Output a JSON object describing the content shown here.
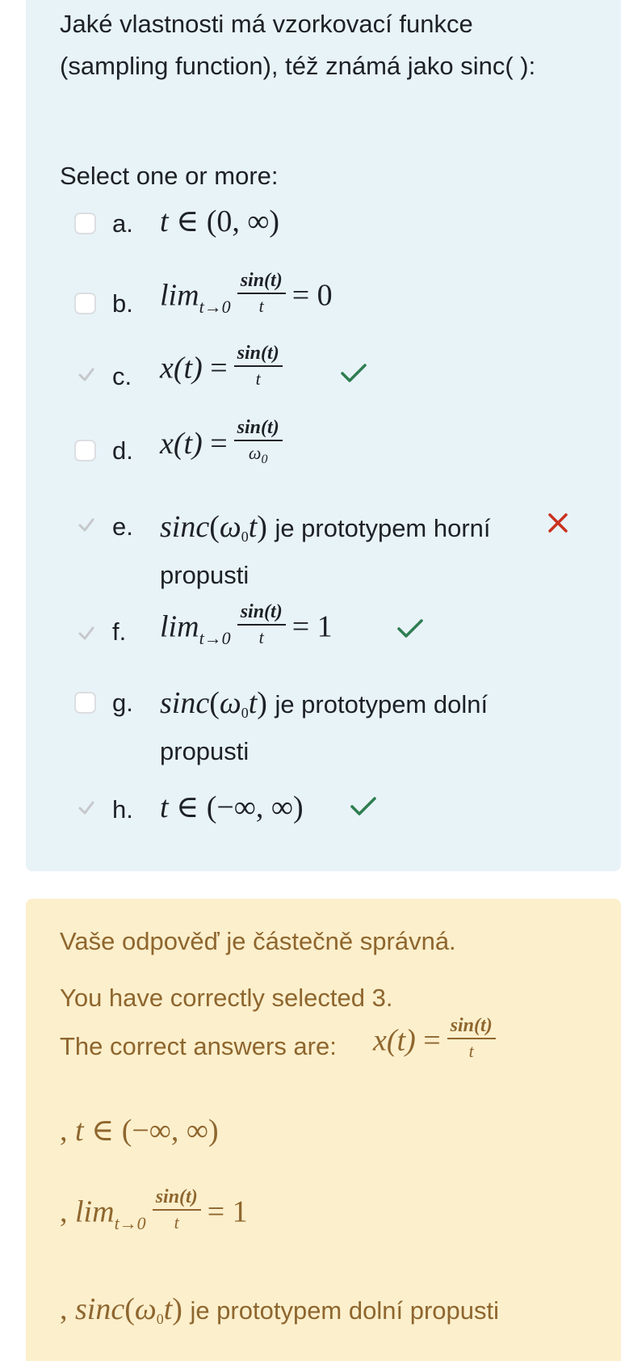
{
  "question": {
    "text": "Jaké vlastnosti má vzorkovací funkce (sampling function), též známá jako sinc( ):",
    "prompt": "Select one or more:"
  },
  "options": [
    {
      "letter": "a.",
      "checked": false,
      "result": null
    },
    {
      "letter": "b.",
      "checked": false,
      "result": null
    },
    {
      "letter": "c.",
      "checked": true,
      "result": "correct"
    },
    {
      "letter": "d.",
      "checked": false,
      "result": null
    },
    {
      "letter": "e.",
      "checked": true,
      "result": "incorrect",
      "text": "je prototypem horní propusti"
    },
    {
      "letter": "f.",
      "checked": true,
      "result": "correct"
    },
    {
      "letter": "g.",
      "checked": false,
      "result": null,
      "text": "je prototypem dolní propusti"
    },
    {
      "letter": "h.",
      "checked": true,
      "result": "correct"
    }
  ],
  "feedback": {
    "status": "Vaše odpověď je částečně správná.",
    "selected": "You have correctly selected 3.",
    "correct_label": "The correct answers are:",
    "tail": "je prototypem dolní propusti"
  },
  "colors": {
    "correct": "#2e7d4f",
    "incorrect": "#ca3120",
    "feedback_text": "#8e662e",
    "question_bg": "#e8f3f8",
    "feedback_bg": "#fcefcc"
  }
}
